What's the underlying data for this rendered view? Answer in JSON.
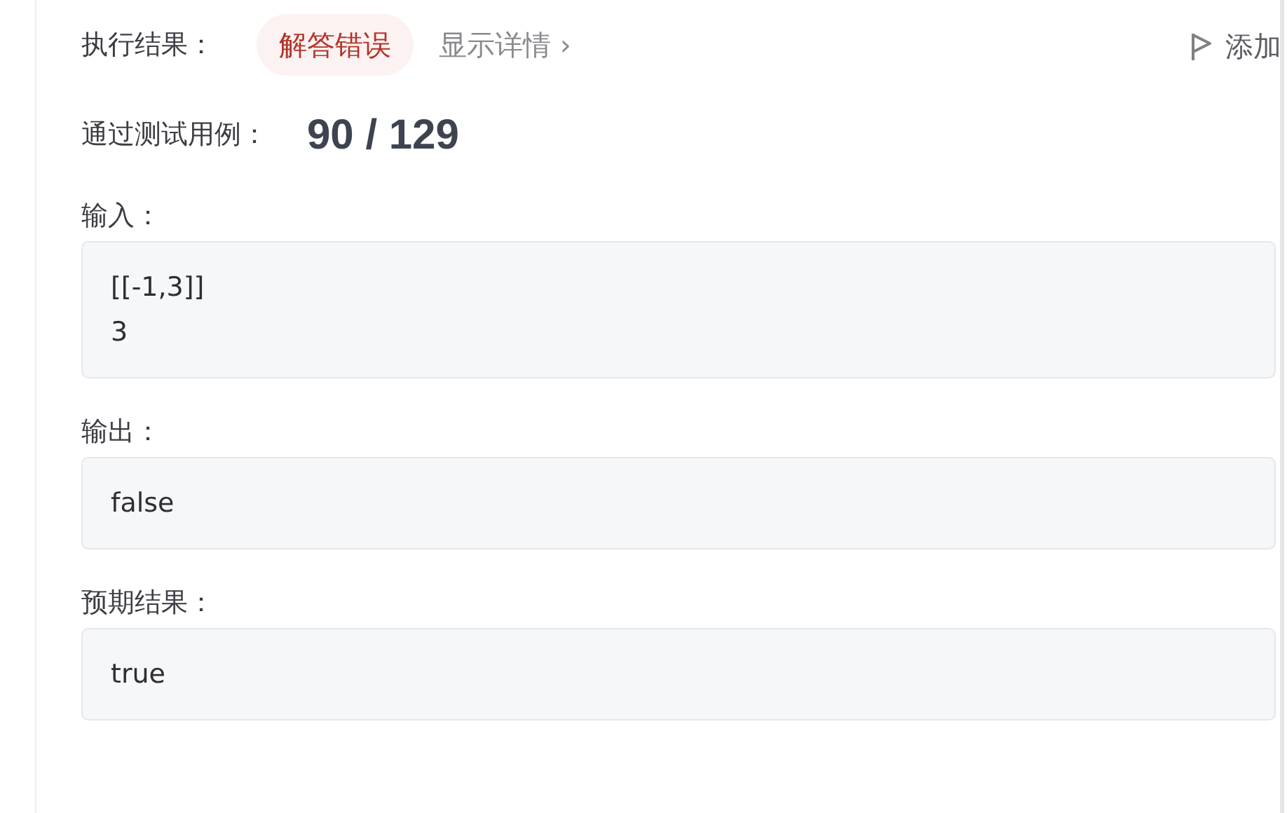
{
  "result": {
    "label": "执行结果：",
    "status": "解答错误",
    "details_link": "显示详情 ›",
    "add_button": "添加"
  },
  "passed": {
    "label": "通过测试用例：",
    "value": "90 / 129"
  },
  "sections": [
    {
      "title": "输入：",
      "lines": [
        "[[-1,3]]",
        "3"
      ]
    },
    {
      "title": "输出：",
      "lines": [
        "false"
      ]
    },
    {
      "title": "预期结果：",
      "lines": [
        "true"
      ]
    }
  ]
}
